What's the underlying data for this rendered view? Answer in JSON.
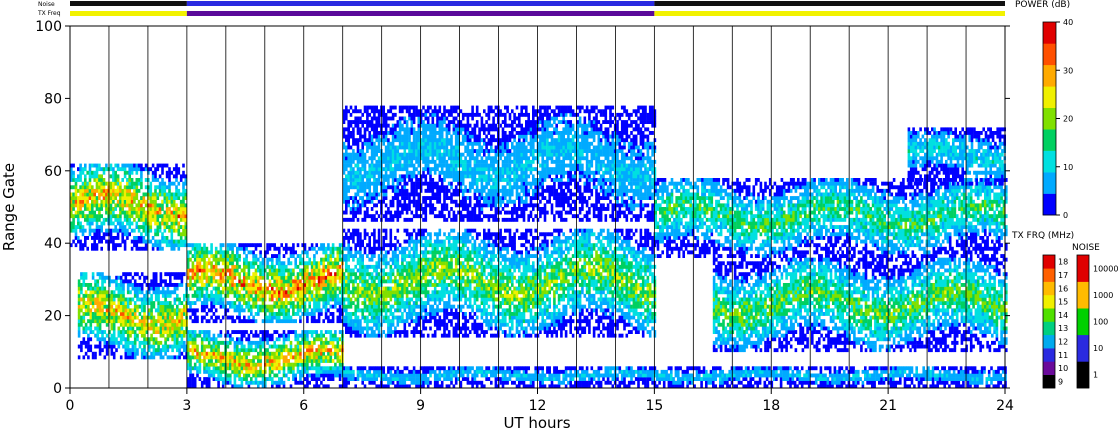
{
  "chart_data": {
    "type": "heatmap",
    "title": "",
    "xlabel": "UT hours",
    "ylabel": "Range Gate",
    "xlim": [
      0,
      24
    ],
    "ylim": [
      0,
      100
    ],
    "x_ticks": [
      "0",
      "3",
      "6",
      "9",
      "12",
      "15",
      "18",
      "21",
      "24"
    ],
    "x_tick_values": [
      0,
      3,
      6,
      9,
      12,
      15,
      18,
      21,
      24
    ],
    "y_ticks": [
      "0",
      "20",
      "40",
      "60",
      "80",
      "100"
    ],
    "y_tick_values": [
      0,
      20,
      40,
      60,
      80,
      100
    ],
    "hour_grid": true,
    "top_strips": {
      "noise_label": "Noise",
      "txfreq_label": "TX Freq",
      "noise_segments": [
        {
          "from": 0,
          "to": 3,
          "color": "#111111"
        },
        {
          "from": 3,
          "to": 15,
          "color": "#2a2ae0"
        },
        {
          "from": 15,
          "to": 24,
          "color": "#111111"
        }
      ],
      "txfreq_segments": [
        {
          "from": 0,
          "to": 3,
          "color": "#f2f200"
        },
        {
          "from": 3,
          "to": 15,
          "color": "#5a0a9a"
        },
        {
          "from": 15,
          "to": 24,
          "color": "#f2f200"
        }
      ]
    },
    "power_scale": {
      "title": "POWER (dB)",
      "ticks": [
        "0",
        "10",
        "20",
        "30",
        "40"
      ],
      "range": [
        0,
        40
      ],
      "colors": [
        "#0000ff",
        "#00aaff",
        "#00e0e0",
        "#00d060",
        "#80e000",
        "#f0f000",
        "#ffaa00",
        "#ff5000",
        "#e00000"
      ]
    },
    "txfreq_scale": {
      "title": "TX FRQ (MHz)",
      "ticks": [
        "9",
        "10",
        "11",
        "12",
        "13",
        "14",
        "15",
        "16",
        "17",
        "18"
      ],
      "colors": [
        "#000000",
        "#6a0a9a",
        "#2a2ae0",
        "#00aaee",
        "#00d080",
        "#50e000",
        "#f0f000",
        "#ffbb00",
        "#ff6000",
        "#e00000"
      ]
    },
    "noise_scale": {
      "title": "NOISE",
      "ticks": [
        "1",
        "10",
        "100",
        "1000",
        "10000"
      ],
      "colors": [
        "#000000",
        "#2a2ae0",
        "#00d000",
        "#ffbb00",
        "#e00000"
      ]
    },
    "echo_bands": [
      {
        "t0": 0.0,
        "t1": 3.0,
        "g0": 38,
        "g1": 62,
        "peak_db": 30
      },
      {
        "t0": 0.2,
        "t1": 3.0,
        "g0": 8,
        "g1": 32,
        "peak_db": 28
      },
      {
        "t0": 3.0,
        "t1": 7.0,
        "g0": 18,
        "g1": 40,
        "peak_db": 33
      },
      {
        "t0": 3.0,
        "t1": 7.0,
        "g0": 0,
        "g1": 16,
        "peak_db": 30
      },
      {
        "t0": 7.0,
        "t1": 15.0,
        "g0": 14,
        "g1": 44,
        "peak_db": 22
      },
      {
        "t0": 7.0,
        "t1": 15.0,
        "g0": 46,
        "g1": 78,
        "peak_db": 10
      },
      {
        "t0": 15.0,
        "t1": 24.0,
        "g0": 36,
        "g1": 58,
        "peak_db": 18
      },
      {
        "t0": 16.5,
        "t1": 24.0,
        "g0": 10,
        "g1": 36,
        "peak_db": 20
      },
      {
        "t0": 21.5,
        "t1": 24.0,
        "g0": 56,
        "g1": 72,
        "peak_db": 12
      },
      {
        "t0": 7.0,
        "t1": 24.0,
        "g0": 0,
        "g1": 6,
        "peak_db": 10
      }
    ]
  }
}
